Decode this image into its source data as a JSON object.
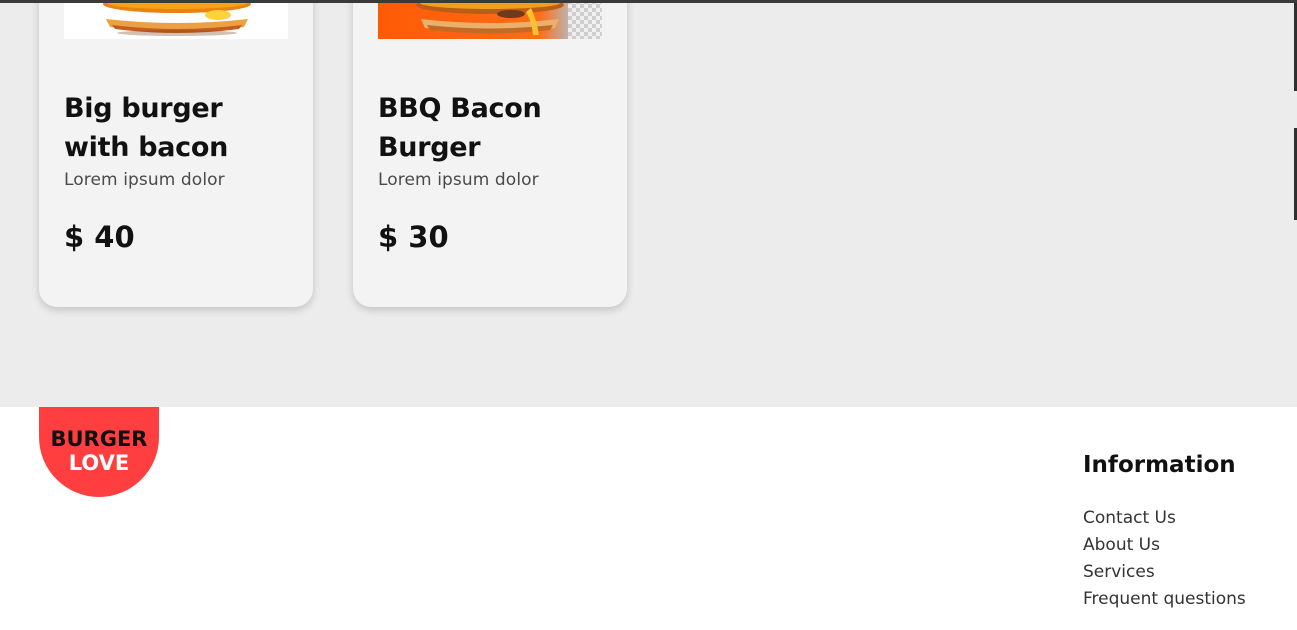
{
  "products": [
    {
      "title": "Big burger with bacon",
      "description": "Lorem ipsum dolor",
      "price": "$ 40"
    },
    {
      "title": "BBQ Bacon Burger",
      "description": "Lorem ipsum dolor",
      "price": "$ 30"
    }
  ],
  "footer": {
    "logo": {
      "line1": "BURGER",
      "line2": "LOVE"
    },
    "information": {
      "title": "Information",
      "links": [
        "Contact Us",
        "About Us",
        "Services",
        "Frequent questions"
      ]
    }
  },
  "colors": {
    "brand": "#ff3f3f",
    "section_background": "#ececec",
    "card_background": "#f3f3f3"
  }
}
